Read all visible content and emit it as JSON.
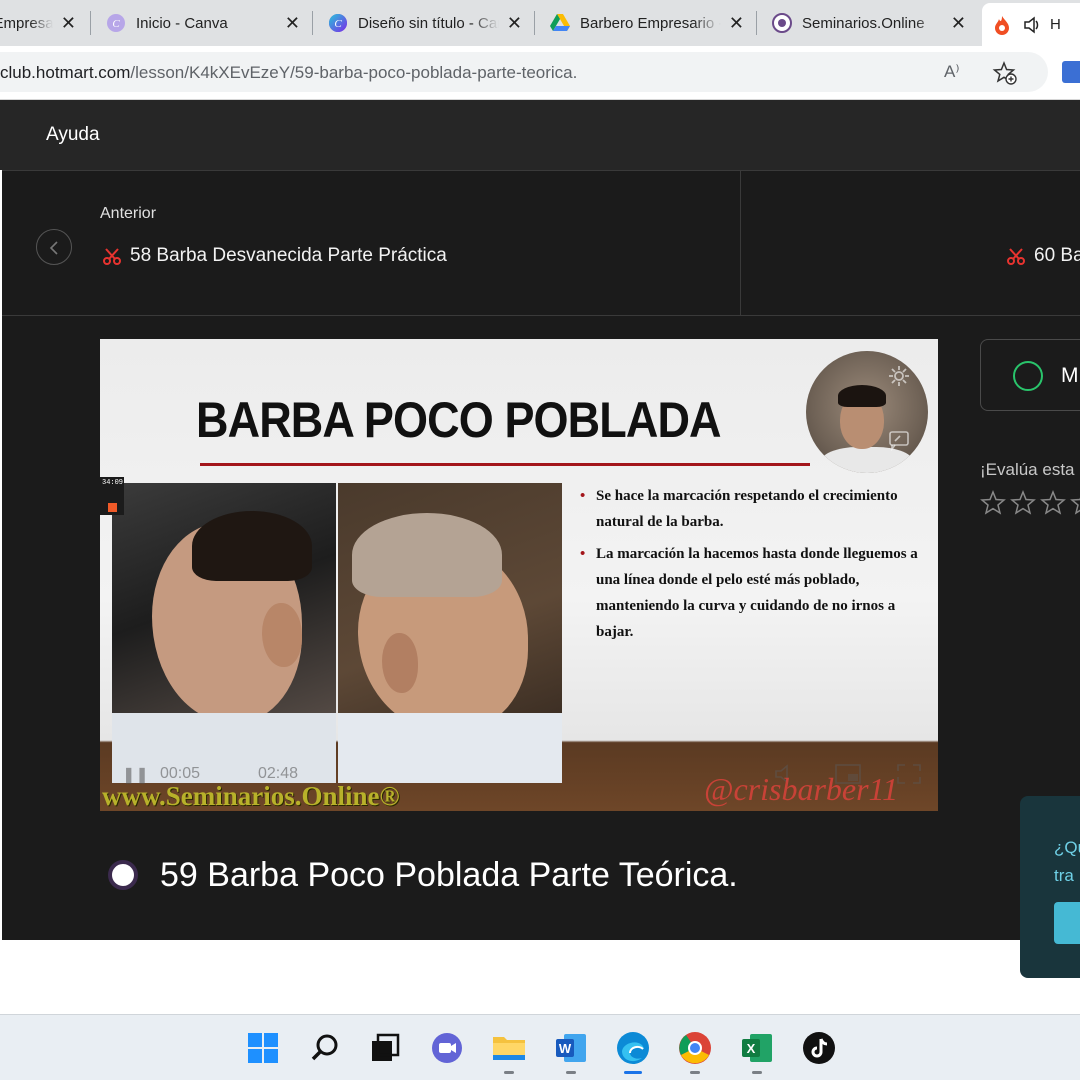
{
  "browser": {
    "tabs": [
      {
        "title": "Barbero Empresario",
        "icon": "orange-square-icon"
      },
      {
        "title": "Inicio - Canva",
        "icon": "canva-icon"
      },
      {
        "title": "Diseño sin título - Canva",
        "icon": "canva-icon"
      },
      {
        "title": "Barbero Empresario - Google Drive",
        "icon": "google-drive-icon"
      },
      {
        "title": "Seminarios.Online",
        "icon": "seminarios-icon"
      },
      {
        "title": "H",
        "icon": "hotmart-flame-icon",
        "active": true
      }
    ],
    "url_host": "club.hotmart.com",
    "url_path": "/lesson/K4kXEvEzeY/59-barba-poco-poblada-parte-teorica.",
    "read_aloud_label": "A⁾"
  },
  "header": {
    "help_label": "Ayuda"
  },
  "lesson_nav": {
    "previous_label": "Anterior",
    "previous_title": "58 Barba Desvanecida Parte Práctica",
    "next_title": "60 Ba"
  },
  "video": {
    "slide_title": "BARBA POCO POBLADA",
    "bullets": [
      "Se hace la marcación respetando el crecimiento natural de la barba.",
      "La marcación la hacemos hasta donde lleguemos a una línea donde el pelo esté más poblado, manteniendo la curva y cuidando de no irnos a bajar."
    ],
    "rec_time": "34:09",
    "time_current": "00:05",
    "time_total": "02:48",
    "site_watermark": "www.Seminarios.Online®",
    "handle_watermark": "@crisbarber11"
  },
  "lesson": {
    "title": "59 Barba Poco Poblada Parte Teórica."
  },
  "sidebar": {
    "complete_label": "M",
    "rate_label": "¡Evalúa esta",
    "stars": 4,
    "help_card_line1": "¿Qu",
    "help_card_line2": "tra"
  },
  "colors": {
    "accent_green": "#29c46b",
    "slide_red": "#a3151b",
    "help_card_bg": "#19353c",
    "help_card_text": "#6fd0e6"
  }
}
